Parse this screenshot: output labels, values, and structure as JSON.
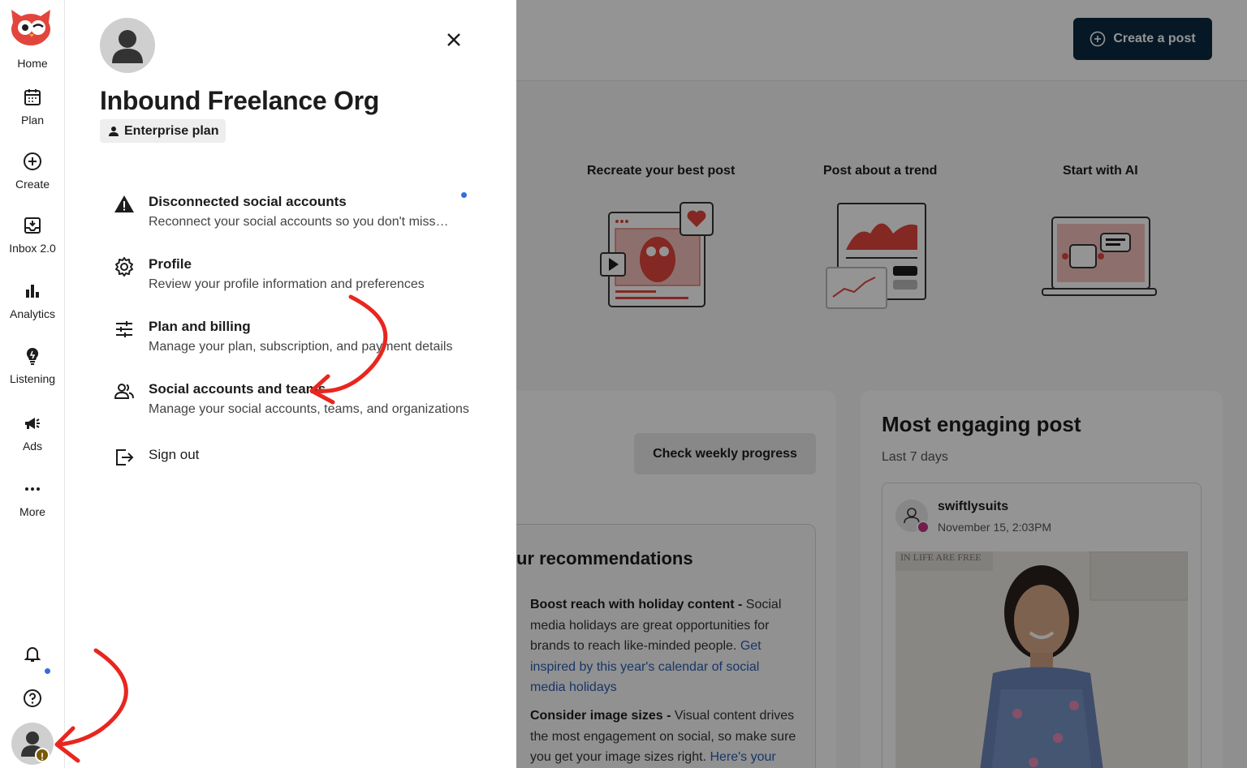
{
  "rail": {
    "items": [
      {
        "label": "Home",
        "icon": "owl-logo-icon"
      },
      {
        "label": "Plan",
        "icon": "calendar-icon"
      },
      {
        "label": "Create",
        "icon": "plus-circle-icon"
      },
      {
        "label": "Inbox 2.0",
        "icon": "inbox-icon"
      },
      {
        "label": "Analytics",
        "icon": "bar-chart-icon"
      },
      {
        "label": "Listening",
        "icon": "lightbulb-icon"
      },
      {
        "label": "Ads",
        "icon": "megaphone-icon"
      },
      {
        "label": "More",
        "icon": "ellipsis-icon"
      }
    ],
    "bottom": [
      "bell-icon",
      "help-icon",
      "profile-avatar"
    ]
  },
  "drawer": {
    "org_name": "Inbound Freelance Org",
    "plan": "Enterprise plan",
    "items": [
      {
        "title": "Disconnected social accounts",
        "desc": "Reconnect your social accounts so you don't miss…",
        "icon": "warning-icon"
      },
      {
        "title": "Profile",
        "desc": "Review your profile information and preferences",
        "icon": "gear-icon"
      },
      {
        "title": "Plan and billing",
        "desc": "Manage your plan, subscription, and payment details",
        "icon": "sliders-icon"
      },
      {
        "title": "Social accounts and teams",
        "desc": "Manage your social accounts, teams, and organizations",
        "icon": "people-icon"
      },
      {
        "title": "Sign out",
        "desc": "",
        "icon": "sign-out-icon"
      }
    ]
  },
  "background": {
    "create_post": "Create a post",
    "cards": [
      "Recreate your best post",
      "Post about a trend",
      "Start with AI"
    ],
    "check_weekly": "Check weekly progress",
    "recs_title": "ur recommendations",
    "recs": [
      {
        "bold": "Boost reach with holiday content -",
        "text": " Social media holidays are great opportunities for brands to reach like-minded people. ",
        "link": "Get inspired by this year's calendar of social media holidays"
      },
      {
        "bold": "Consider image sizes -",
        "text": " Visual content drives the most engagement on social, so make sure you get your image sizes right. ",
        "link": "Here's your"
      }
    ],
    "engaging_title": "Most engaging post",
    "engaging_sub": "Last 7 days",
    "post_user": "swiftlysuits",
    "post_date": "November 15, 2:03PM",
    "post_sign": "IN LIFE ARE FREE"
  },
  "colors": {
    "brand_red": "#e2453c",
    "annotation_red": "#e8261f",
    "button_navy": "#0b2a40",
    "notice_blue": "#2f6fdf"
  }
}
